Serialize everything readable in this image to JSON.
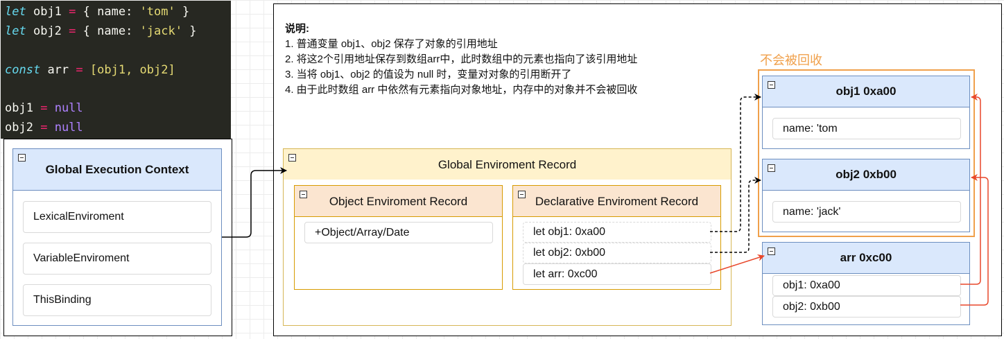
{
  "code": {
    "line1": {
      "kw": "let",
      "name": "obj1",
      "op": "=",
      "pre": "{ name: ",
      "str": "'tom'",
      "post": " }"
    },
    "line2": {
      "kw": "let",
      "name": "obj2",
      "op": "=",
      "pre": "{ name: ",
      "str": "'jack'",
      "post": " }"
    },
    "line3": {
      "kw": "const",
      "name": "arr",
      "op": "=",
      "post": "[obj1, obj2]"
    },
    "line4": {
      "name": "obj1",
      "op": "=",
      "value": "null"
    },
    "line5": {
      "name": "obj2",
      "op": "=",
      "value": "null"
    }
  },
  "gec": {
    "title": "Global Execution Context",
    "items": [
      "LexicalEnviroment",
      "VariableEnviroment",
      "ThisBinding"
    ]
  },
  "notes": {
    "heading": "说明:",
    "lines": [
      "1. 普通变量 obj1、obj2 保存了对象的引用地址",
      "2. 将这2个引用地址保存到数组arr中，此时数组中的元素也指向了该引用地址",
      "3. 当将 obj1、obj2 的值设为 null 时，变量对对象的引用断开了",
      "4. 由于此时数组 arr 中依然有元素指向对象地址，内存中的对象并不会被回收"
    ]
  },
  "ger": {
    "title": "Global Enviroment Record",
    "object_record": {
      "title": "Object Enviroment Record",
      "items": [
        "+Object/Array/Date"
      ]
    },
    "declarative_record": {
      "title": "Declarative Enviroment Record",
      "items": [
        "let obj1: 0xa00",
        "let obj2: 0xb00",
        "let arr: 0xc00"
      ]
    }
  },
  "heap": {
    "label": "不会被回收",
    "obj1": {
      "title": "obj1 0xa00",
      "field": "name: 'tom"
    },
    "obj2": {
      "title": "obj2 0xb00",
      "field": "name: 'jack'"
    },
    "arr": {
      "title": "arr 0xc00",
      "items": [
        "obj1: 0xa00",
        "obj2: 0xb00"
      ]
    }
  },
  "colors": {
    "orange": "#f0a04b",
    "red_arrow": "#e8472a",
    "blue_header": "#dae8fc",
    "gold_header": "#fff2cc",
    "orange_header": "#fbe5d0"
  }
}
